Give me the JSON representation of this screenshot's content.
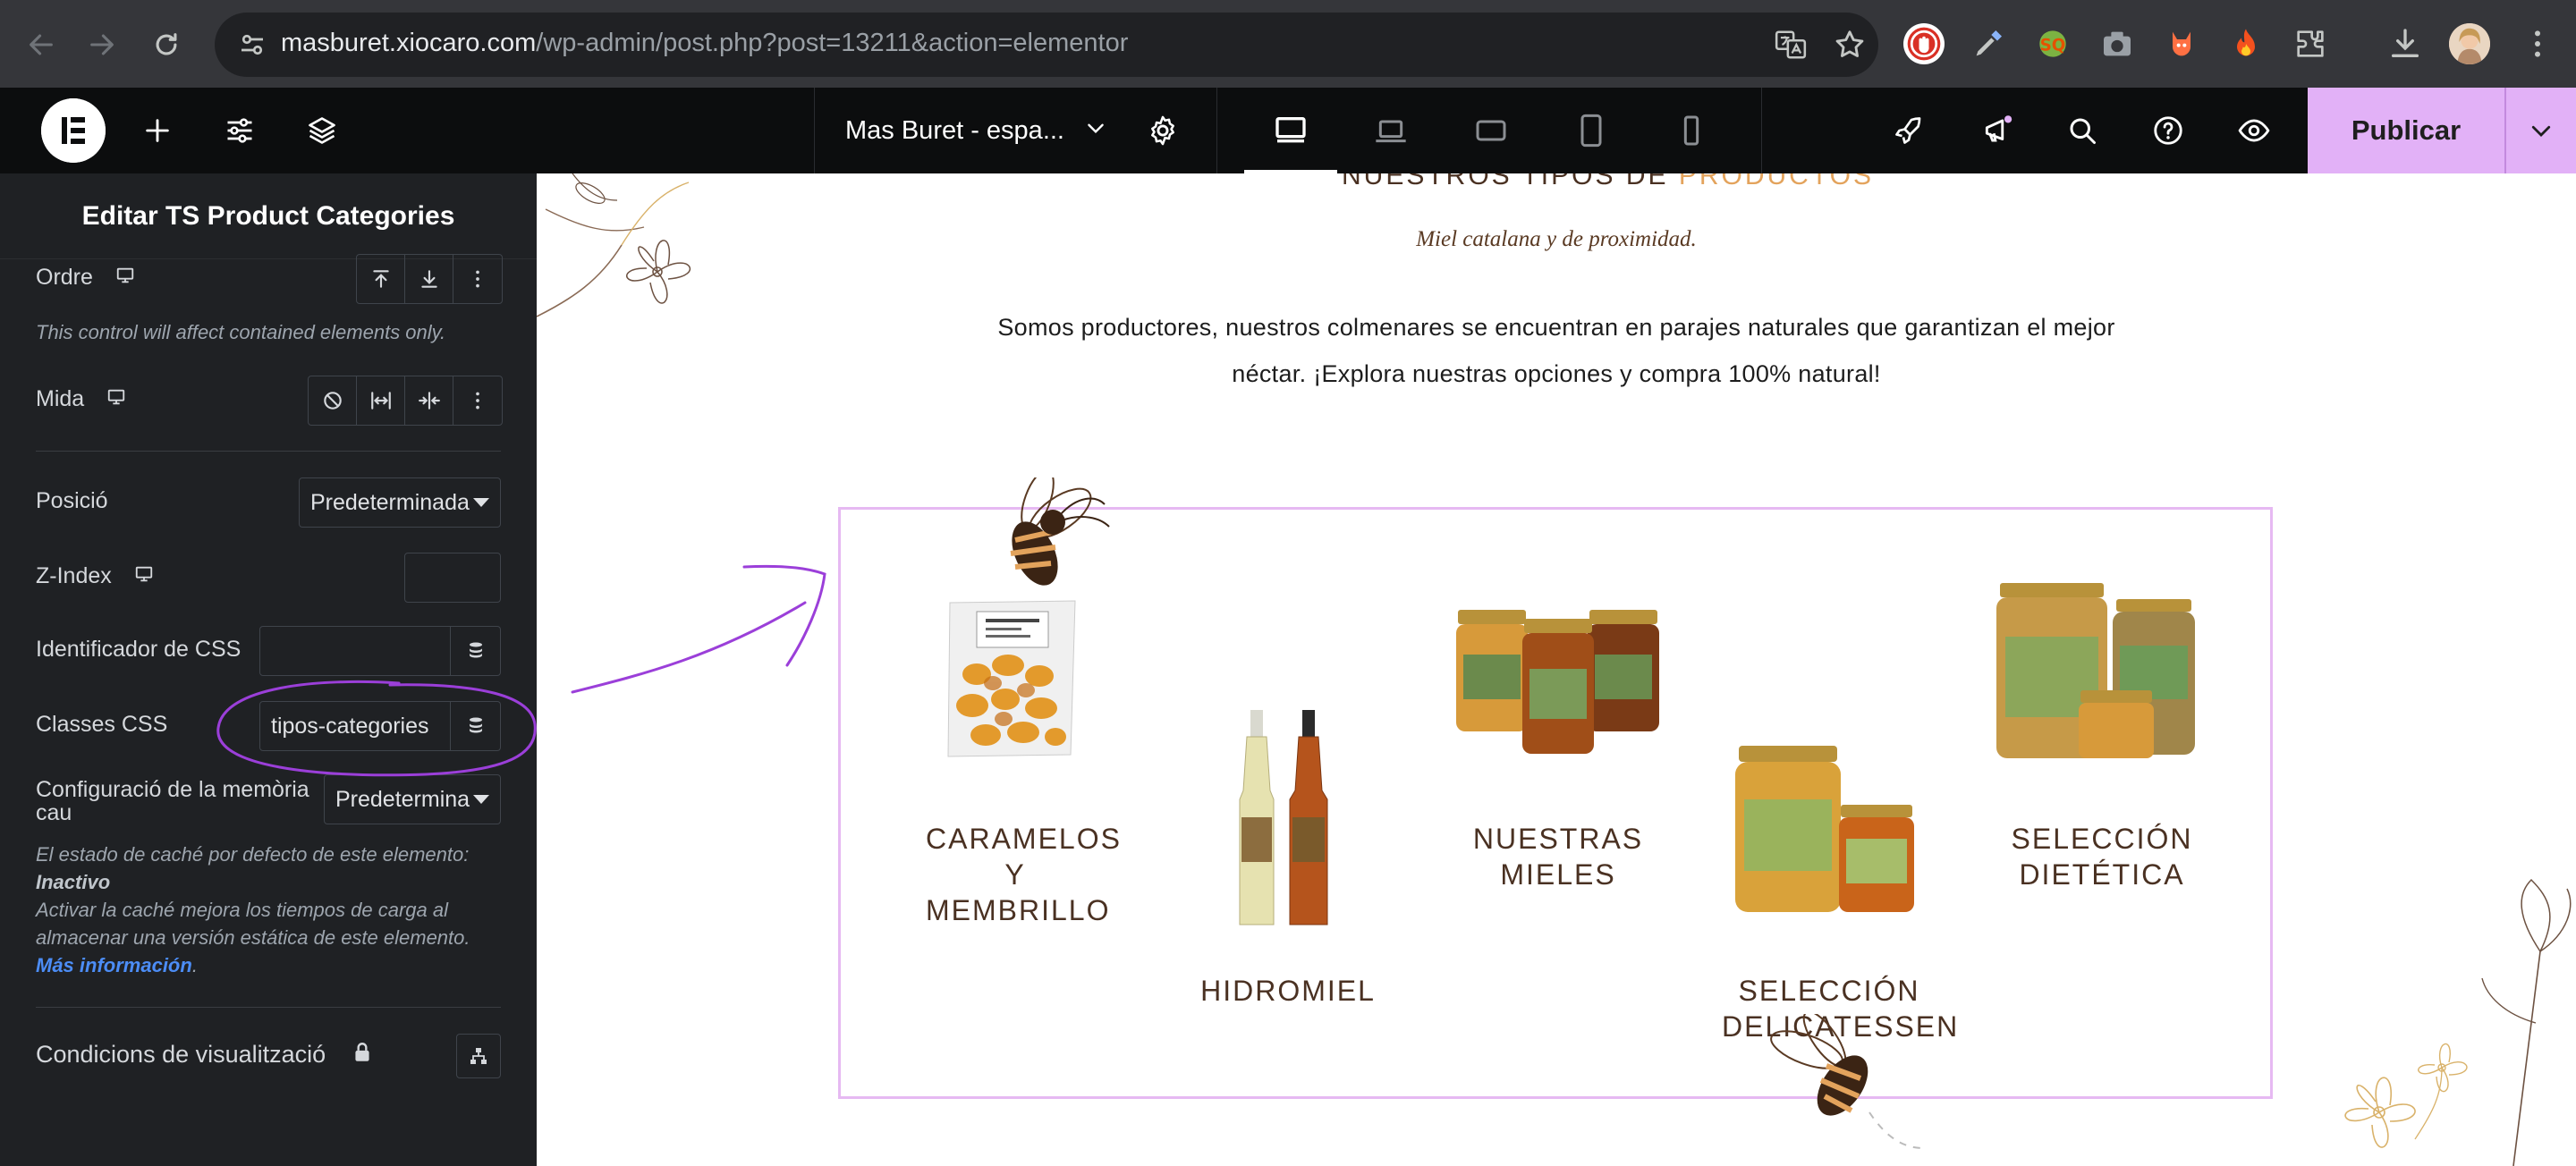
{
  "browser": {
    "url_host": "masburet.xiocaro.com",
    "url_path": "/wp-admin/post.php?post=13211&action=elementor"
  },
  "topbar": {
    "document_title": "Mas Buret - espa...",
    "publish_label": "Publicar"
  },
  "panel": {
    "title": "Editar TS Product Categories",
    "order_label": "Ordre",
    "order_note": "This control will affect contained elements only.",
    "size_label": "Mida",
    "position_label": "Posició",
    "position_value": "Predeterminada",
    "zindex_label": "Z-Index",
    "zindex_value": "",
    "css_id_label": "Identificador de CSS",
    "css_id_value": "",
    "css_classes_label": "Classes CSS",
    "css_classes_value": "tipos-categories",
    "cache_label_line1": "Configuració de la memòria",
    "cache_label_line2": "cau",
    "cache_value": "Predetermina",
    "cache_note_line1": "El estado de caché por defecto de este elemento:",
    "cache_note_state": "Inactivo",
    "cache_note_line2": "Activar la caché mejora los tiempos de carga al",
    "cache_note_line3": "almacenar una versión estática de este elemento.",
    "cache_more_link": "Más información",
    "cache_more_dot": ".",
    "visibility_label": "Condicions de visualització"
  },
  "canvas": {
    "section_title_main": "NUESTROS TIPOS DE ",
    "section_title_accent": "PRODUCTOS",
    "subtitle": "Miel catalana y de proximidad.",
    "lead_line1": "Somos productores, nuestros colmenares se encuentran en parajes naturales que garantizan el mejor",
    "lead_line2": "néctar. ¡Explora nuestras opciones y compra 100% natural!",
    "categories": [
      {
        "line1": "CARAMELOS",
        "line2": "Y",
        "line3": "MEMBRILLO"
      },
      {
        "line1": "HIDROMIEL"
      },
      {
        "line1": "NUESTRAS",
        "line2": "MIELES"
      },
      {
        "line1": "SELECCIÓN",
        "line2": "DELICATESSEN"
      },
      {
        "line1": "SELECCIÓN",
        "line2": "DIETÉTICA"
      }
    ]
  },
  "colors": {
    "accent_purple": "#e2b1f7",
    "panel_bg": "#1f2124",
    "brand_brown": "#4a3122",
    "title_accent": "#e3a35c"
  }
}
